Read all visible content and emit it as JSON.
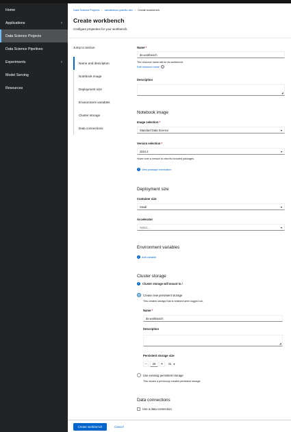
{
  "sidebar": {
    "items": [
      {
        "label": "Home",
        "chevron": ""
      },
      {
        "label": "Applications",
        "chevron": "›"
      },
      {
        "label": "Data Science Projects",
        "chevron": ""
      },
      {
        "label": "Data Science Pipelines",
        "chevron": ""
      },
      {
        "label": "Experiments",
        "chevron": "›"
      },
      {
        "label": "Model Serving",
        "chevron": ""
      },
      {
        "label": "Resources",
        "chevron": ""
      }
    ],
    "active_index": 2
  },
  "breadcrumb": {
    "items": [
      "Data Science Projects",
      "ramaktahov-yokofix-dev",
      "Create workbench"
    ],
    "separator": "›"
  },
  "page": {
    "title": "Create workbench",
    "description": "Configure properties for your workbench."
  },
  "jump": {
    "heading": "Jump to section",
    "items": [
      "Name and description",
      "Notebook image",
      "Deployment size",
      "Environment variables",
      "Cluster storage",
      "Data connections"
    ],
    "active_index": 0
  },
  "name_section": {
    "name_label": "Name",
    "required_mark": "*",
    "name_value": "ds-workbench",
    "resource_helper": "The resource name will be ds-workbench.",
    "edit_resource_link": "Edit resource name",
    "help_icon": "?",
    "description_label": "Description"
  },
  "notebook_image": {
    "title": "Notebook image",
    "image_label": "Image selection",
    "image_value": "Standard Data Science",
    "version_label": "Version selection",
    "version_value": "2024.2",
    "version_helper": "Hover over a version to view its included packages.",
    "package_link": "View package information"
  },
  "deployment": {
    "title": "Deployment size",
    "container_label": "Container size",
    "container_value": "Small",
    "accelerator_label": "Accelerator",
    "accelerator_value": "Select..."
  },
  "env": {
    "title": "Environment variables",
    "add_link": "Add variable"
  },
  "storage": {
    "title": "Cluster storage",
    "info_text": "Cluster storage will mount to /",
    "create_option": "Create new persistent storage",
    "create_helper": "This creates storage that is retained when logged out.",
    "name_label": "Name",
    "name_value": "ds-workbench",
    "description_label": "Description",
    "size_label": "Persistent storage size",
    "minus": "−",
    "size_value": "20",
    "plus": "+",
    "unit": "Gi",
    "existing_option": "Use existing persistent storage",
    "existing_helper": "This reuses a previously created persistent storage."
  },
  "data_connections": {
    "title": "Data connections",
    "checkbox_label": "Use a data connection"
  },
  "footer": {
    "create_button": "Create workbench",
    "cancel_button": "Cancel"
  },
  "icons": {
    "caret": "▾",
    "resize": "◢",
    "info": "i",
    "plus": "+"
  },
  "colors": {
    "accent": "#0066cc",
    "sidebar_bg": "#212427",
    "required": "#c9190b"
  }
}
